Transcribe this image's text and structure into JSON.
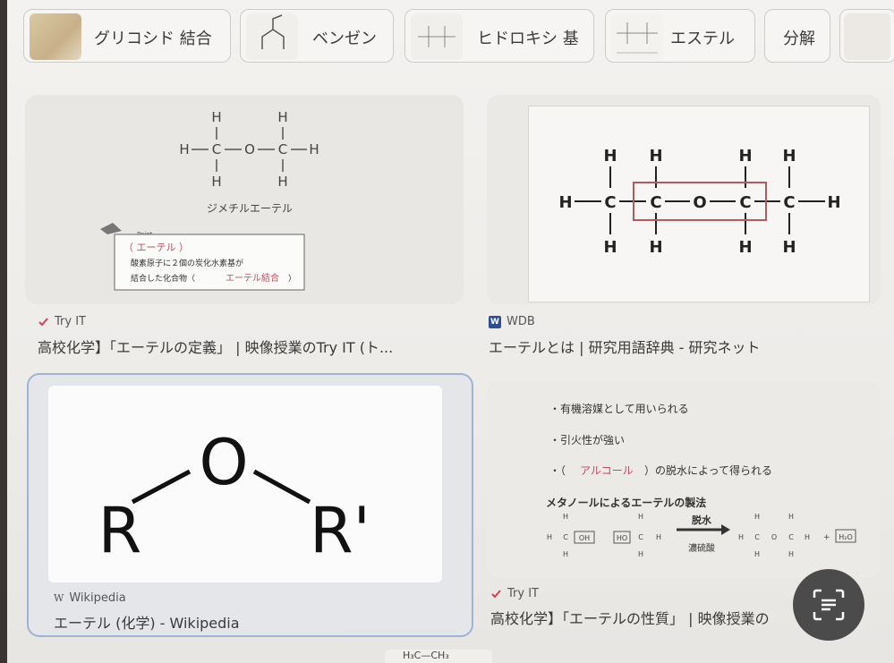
{
  "chips": [
    {
      "label": "グリコシド 結合",
      "thumb_icon": "glycoside-thumb-icon"
    },
    {
      "label": "ベンゼン",
      "thumb_icon": "benzene-thumb-icon"
    },
    {
      "label": "ヒドロキシ 基",
      "thumb_icon": "hydroxy-thumb-icon"
    },
    {
      "label": "エステル",
      "thumb_icon": "ester-thumb-icon"
    },
    {
      "label": "分解",
      "thumb_icon": ""
    }
  ],
  "results": [
    {
      "source": "Try IT",
      "title": "高校化学】「エーテルの定義」 | 映像授業のTry IT (ト...",
      "image": {
        "caption": "ジメチルエーテル",
        "point_label": "Point",
        "note_handwritten": "（ エーテル ）",
        "note_line1": "酸素原子に２個の炭化水素基が",
        "note_line2_prefix": "結合した化合物（",
        "note_line2_hand": "エーテル結合",
        "note_line2_suffix": "）"
      }
    },
    {
      "source": "WDB",
      "title": "エーテルとは | 研究用語辞典 - 研究ネット"
    },
    {
      "source": "Wikipedia",
      "title": "エーテル (化学) - Wikipedia",
      "image": {
        "left": "R",
        "center": "O",
        "right": "R'"
      }
    },
    {
      "source": "Try IT",
      "title": "高校化学】「エーテルの性質」 | 映像授業の",
      "image": {
        "bullet1": "・有機溶媒として用いられる",
        "bullet2": "・引火性が強い",
        "bullet3_prefix": "・（",
        "bullet3_hand": "アルコール",
        "bullet3_suffix": "）の脱水によって得られる",
        "heading": "メタノールによるエーテルの製法",
        "arrow_top": "脱水",
        "arrow_bottom": "濃硫酸",
        "plus": "+",
        "water": "H₂O"
      }
    }
  ],
  "bottom_peek": {
    "text": "H₃C—CH₃"
  },
  "atoms": {
    "H": "H",
    "C": "C",
    "O": "O",
    "OH": "OH",
    "HO": "HO"
  }
}
